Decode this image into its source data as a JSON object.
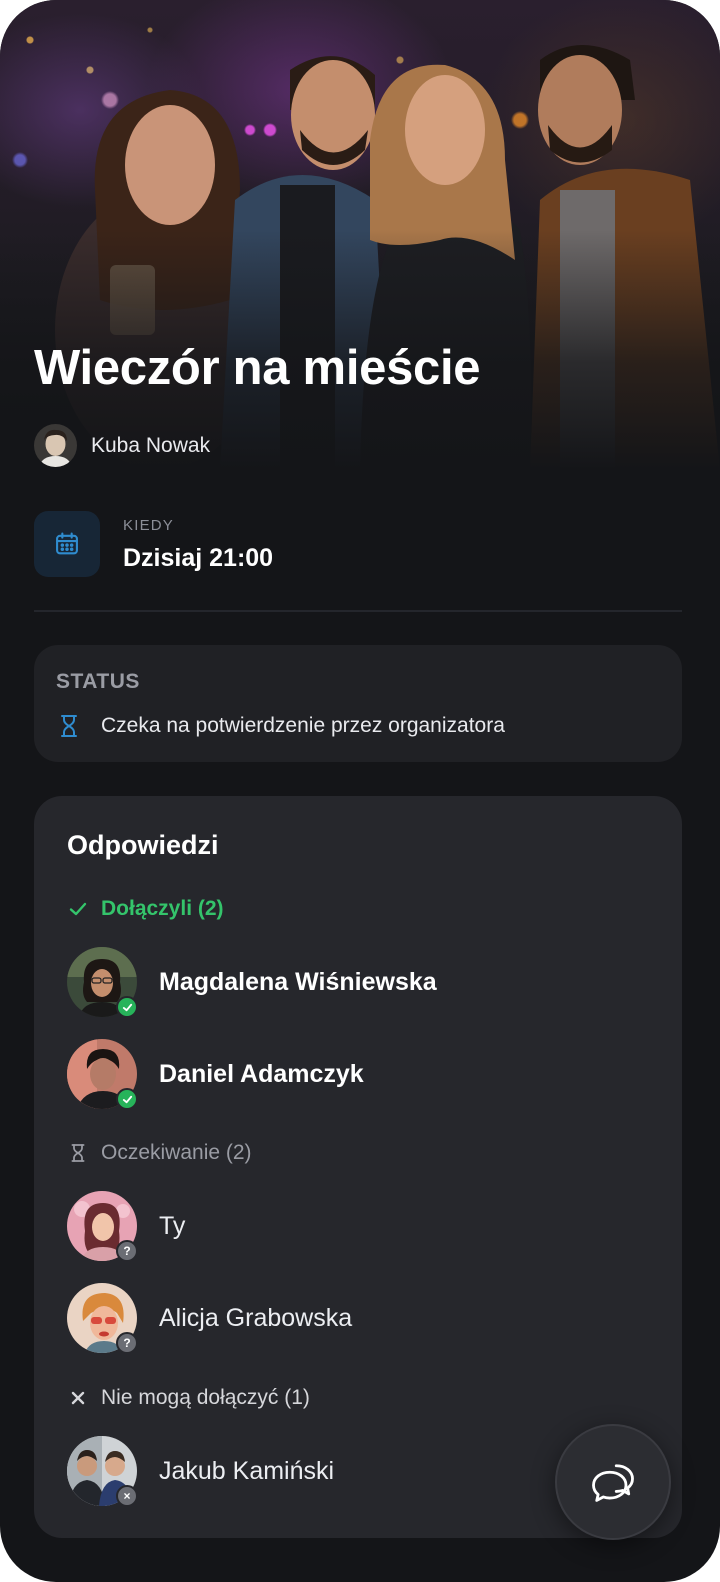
{
  "event": {
    "title": "Wieczór na mieście",
    "organizer": "Kuba Nowak"
  },
  "when": {
    "label": "KIEDY",
    "value": "Dzisiaj 21:00",
    "icon": "calendar-icon"
  },
  "status": {
    "title": "STATUS",
    "text": "Czeka na potwierdzenie przez organizatora",
    "icon": "hourglass-icon"
  },
  "responses": {
    "title": "Odpowiedzi",
    "groups": [
      {
        "label": "Dołączyli (2)",
        "icon": "check-icon",
        "color": "#34c46b",
        "people": [
          {
            "name": "Magdalena Wiśniewska",
            "badge": "check"
          },
          {
            "name": "Daniel Adamczyk",
            "badge": "check"
          }
        ]
      },
      {
        "label": "Oczekiwanie (2)",
        "icon": "hourglass-icon",
        "people": [
          {
            "name": "Ty",
            "badge": "?"
          },
          {
            "name": "Alicja Grabowska",
            "badge": "?"
          }
        ]
      },
      {
        "label": "Nie mogą dołączyć (1)",
        "icon": "x-icon",
        "people": [
          {
            "name": "Jakub Kamiński",
            "badge": "×"
          }
        ]
      }
    ]
  },
  "colors": {
    "background": "#141518",
    "card": "#26272c",
    "accent_blue": "#2f8ccf",
    "joined_green": "#34c46b"
  }
}
